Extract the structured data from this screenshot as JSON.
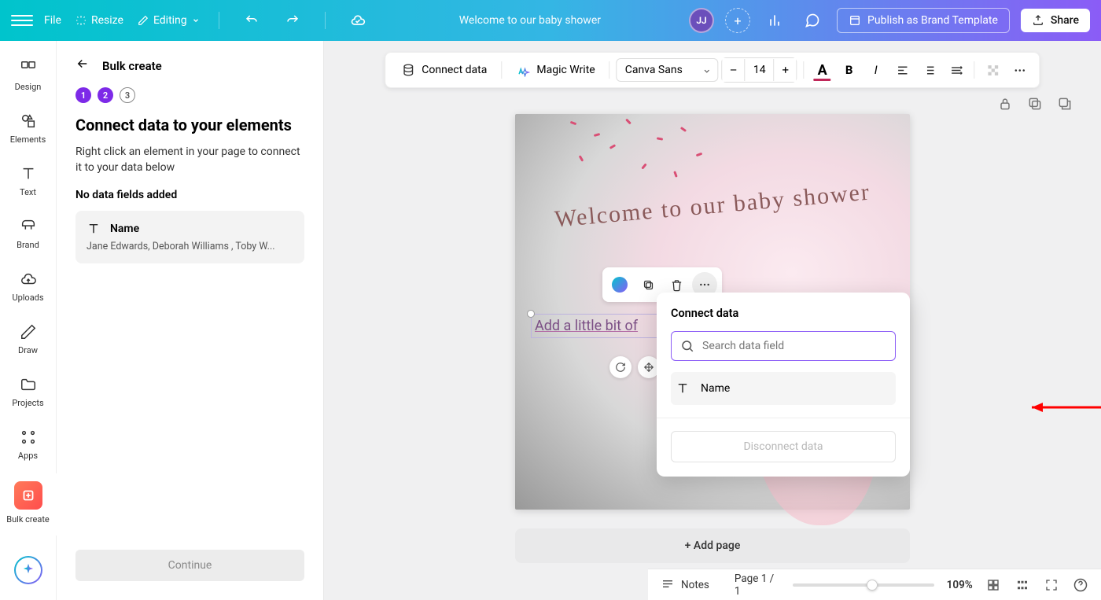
{
  "doc_title": "Welcome to our baby shower",
  "top": {
    "file": "File",
    "resize": "Resize",
    "editing": "Editing",
    "avatar": "JJ",
    "publish": "Publish as Brand Template",
    "share": "Share"
  },
  "rail": {
    "design": "Design",
    "elements": "Elements",
    "text": "Text",
    "brand": "Brand",
    "uploads": "Uploads",
    "draw": "Draw",
    "projects": "Projects",
    "apps": "Apps",
    "bulk": "Bulk create"
  },
  "panel": {
    "title": "Bulk create",
    "step1": "1",
    "step2": "2",
    "step3": "3",
    "heading": "Connect data to your elements",
    "desc": "Right click an element in your page to connect it to your data below",
    "sub": "No data fields added",
    "field_name": "Name",
    "field_values": "Jane Edwards, Deborah Williams , Toby W...",
    "continue": "Continue"
  },
  "toolbar": {
    "connect": "Connect data",
    "magic": "Magic Write",
    "font": "Canva Sans",
    "size": "14"
  },
  "canvas": {
    "script": "Welcome to our baby shower",
    "placeholder": "Add a little bit of"
  },
  "popover": {
    "title": "Connect data",
    "search_placeholder": "Search data field",
    "item": "Name",
    "disconnect": "Disconnect data"
  },
  "addpage": "+ Add page",
  "bottom": {
    "notes": "Notes",
    "page": "Page 1 / 1",
    "zoom": "109%"
  }
}
